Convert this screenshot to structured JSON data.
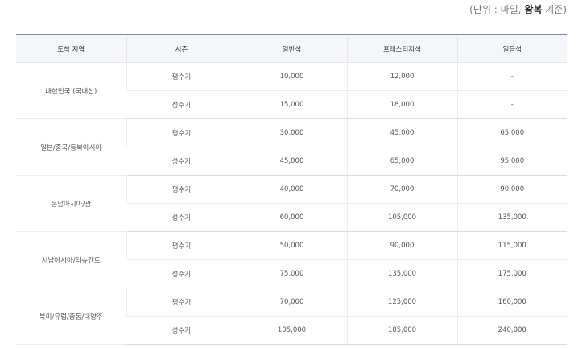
{
  "note": {
    "prefix": "(단위 : 마일, ",
    "bold": "왕복",
    "suffix": " 기준)"
  },
  "headers": [
    "도착 지역",
    "시즌",
    "일반석",
    "프레스티지석",
    "일등석"
  ],
  "regions": [
    {
      "name": "대한민국 (국내선)",
      "rows": [
        {
          "season": "평수기",
          "economy": "10,000",
          "prestige": "12,000",
          "first": "-"
        },
        {
          "season": "성수기",
          "economy": "15,000",
          "prestige": "18,000",
          "first": "-"
        }
      ]
    },
    {
      "name": "일본/중국/동북아시아",
      "rows": [
        {
          "season": "평수기",
          "economy": "30,000",
          "prestige": "45,000",
          "first": "65,000"
        },
        {
          "season": "성수기",
          "economy": "45,000",
          "prestige": "65,000",
          "first": "95,000"
        }
      ]
    },
    {
      "name": "동남아시아/괌",
      "rows": [
        {
          "season": "평수기",
          "economy": "40,000",
          "prestige": "70,000",
          "first": "90,000"
        },
        {
          "season": "성수기",
          "economy": "60,000",
          "prestige": "105,000",
          "first": "135,000"
        }
      ]
    },
    {
      "name": "서남아시아/타슈켄트",
      "rows": [
        {
          "season": "평수기",
          "economy": "50,000",
          "prestige": "90,000",
          "first": "115,000"
        },
        {
          "season": "성수기",
          "economy": "75,000",
          "prestige": "135,000",
          "first": "175,000"
        }
      ]
    },
    {
      "name": "북미/유럽/중동/대양주",
      "rows": [
        {
          "season": "평수기",
          "economy": "70,000",
          "prestige": "125,000",
          "first": "160,000"
        },
        {
          "season": "성수기",
          "economy": "105,000",
          "prestige": "185,000",
          "first": "240,000"
        }
      ]
    }
  ]
}
